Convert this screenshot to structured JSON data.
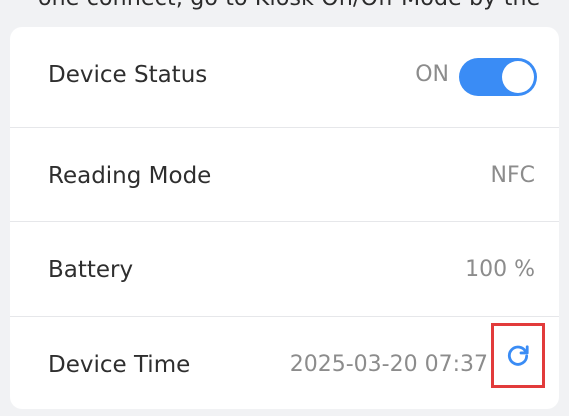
{
  "header_cut_text": "one connect, go to Kiosk On/Off Mode by the",
  "rows": [
    {
      "label": "Device Status",
      "value": "ON",
      "toggle_state": "on"
    },
    {
      "label": "Reading Mode",
      "value": "NFC"
    },
    {
      "label": "Battery",
      "value": "100 %"
    },
    {
      "label": "Device Time",
      "value": "2025-03-20 07:37"
    }
  ],
  "colors": {
    "accent": "#3a8cf5",
    "highlight_box": "#e23b3b",
    "background": "#f1f2f4",
    "card": "#ffffff",
    "label_text": "#2e2e2e",
    "value_text": "#8c8c8c"
  },
  "icons": {
    "refresh": "refresh-icon"
  }
}
